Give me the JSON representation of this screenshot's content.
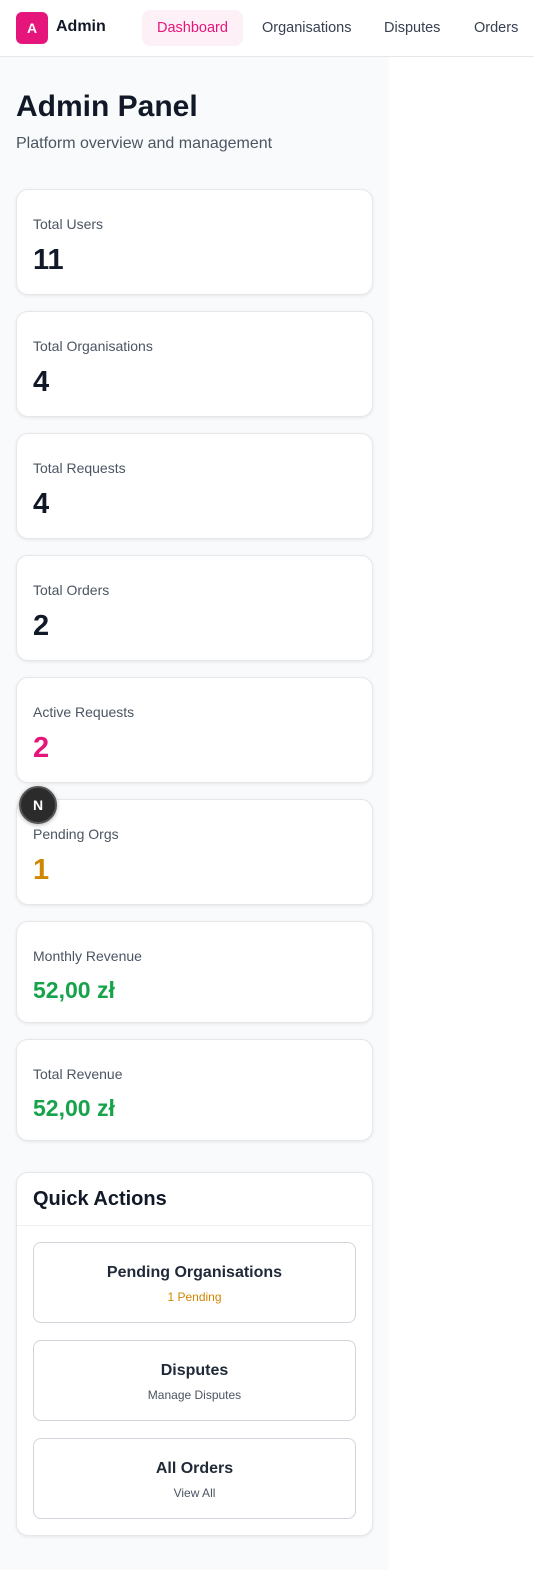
{
  "header": {
    "logo_letter": "A",
    "brand": "Admin",
    "tabs": [
      {
        "label": "Dashboard",
        "active": true
      },
      {
        "label": "Organisations",
        "active": false
      },
      {
        "label": "Disputes",
        "active": false
      },
      {
        "label": "Orders",
        "active": false
      }
    ]
  },
  "page": {
    "title": "Admin Panel",
    "subtitle": "Platform overview and management"
  },
  "stats": [
    {
      "label": "Total Users",
      "value": "11",
      "color": "#111827"
    },
    {
      "label": "Total Organisations",
      "value": "4",
      "color": "#111827"
    },
    {
      "label": "Total Requests",
      "value": "4",
      "color": "#111827"
    },
    {
      "label": "Total Orders",
      "value": "2",
      "color": "#111827"
    },
    {
      "label": "Active Requests",
      "value": "2",
      "color": "#e6157c"
    },
    {
      "label": "Pending Orgs",
      "value": "1",
      "color": "#d08700"
    },
    {
      "label": "Monthly Revenue",
      "value": "52,00 zł",
      "color": "#16a34a"
    },
    {
      "label": "Total Revenue",
      "value": "52,00 zł",
      "color": "#16a34a"
    }
  ],
  "quick_actions": {
    "title": "Quick Actions",
    "items": [
      {
        "title": "Pending Organisations",
        "subtitle": "1 Pending",
        "subtitle_color": "#d08700"
      },
      {
        "title": "Disputes",
        "subtitle": "Manage Disputes",
        "subtitle_color": "#4b5563"
      },
      {
        "title": "All Orders",
        "subtitle": "View All",
        "subtitle_color": "#4b5563"
      }
    ]
  },
  "dev_badge": {
    "letter": "N"
  }
}
